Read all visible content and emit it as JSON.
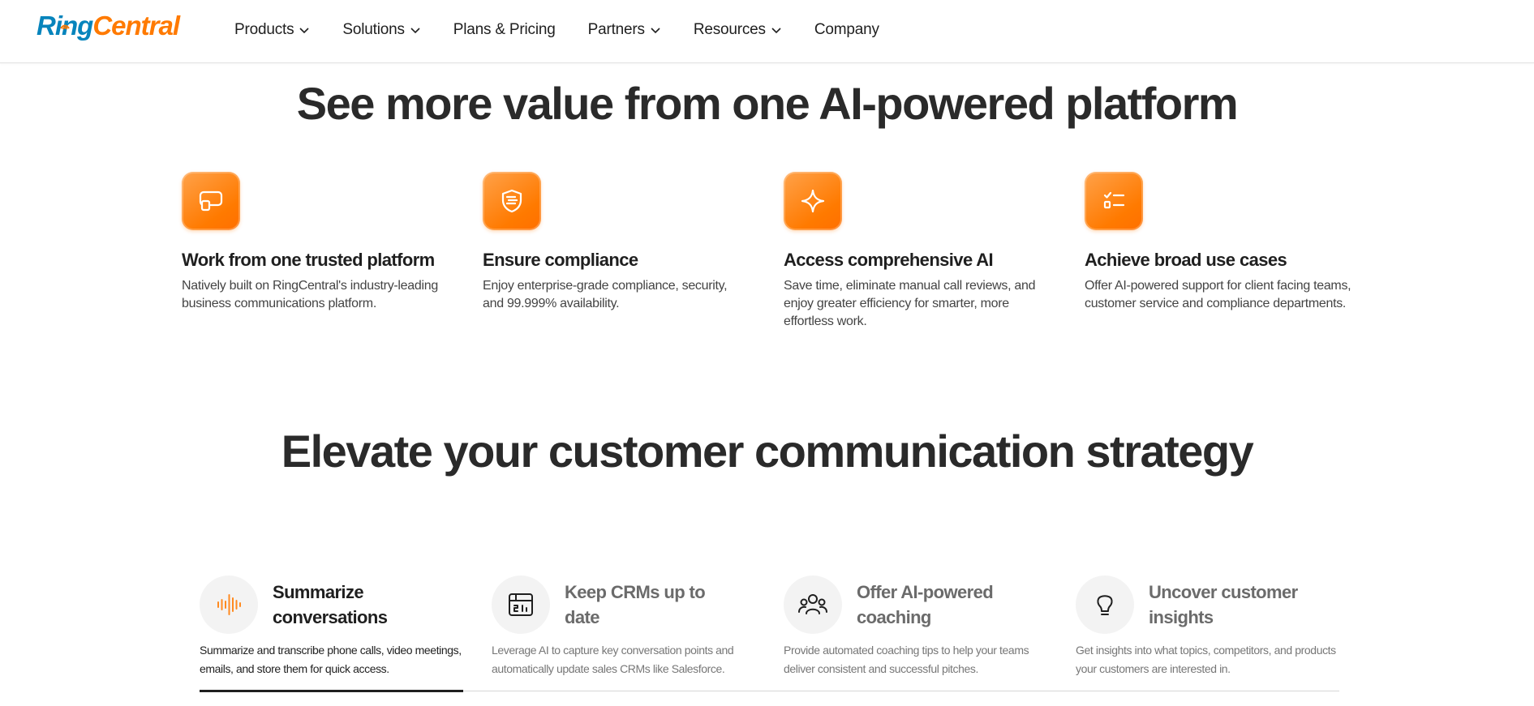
{
  "header": {
    "logo": {
      "ring": "Ring",
      "central": "Central"
    },
    "nav": [
      {
        "label": "Products",
        "has_dropdown": true
      },
      {
        "label": "Solutions",
        "has_dropdown": true
      },
      {
        "label": "Plans & Pricing",
        "has_dropdown": false
      },
      {
        "label": "Partners",
        "has_dropdown": true
      },
      {
        "label": "Resources",
        "has_dropdown": true
      },
      {
        "label": "Company",
        "has_dropdown": false
      }
    ]
  },
  "section_value": {
    "title": "See more value from one AI-powered platform",
    "features": [
      {
        "icon": "platform-icon",
        "title": "Work from one trusted platform",
        "desc": "Natively built on RingCentral's industry-leading business communications platform."
      },
      {
        "icon": "shield-icon",
        "title": "Ensure compliance",
        "desc": "Enjoy enterprise-grade compliance, security, and 99.999% availability."
      },
      {
        "icon": "sparkle-icon",
        "title": "Access comprehensive AI",
        "desc": "Save time, eliminate manual call reviews, and enjoy greater efficiency for smarter, more effortless work."
      },
      {
        "icon": "checklist-icon",
        "title": "Achieve broad use cases",
        "desc": "Offer AI-powered support for client facing teams, customer service and compliance departments."
      }
    ]
  },
  "section_strategy": {
    "title": "Elevate your customer communication strategy",
    "tabs": [
      {
        "icon": "audio-wave-icon",
        "title": "Summarize conversations",
        "desc": "Summarize and transcribe phone calls, video meetings, emails, and store them for quick access.",
        "active": true
      },
      {
        "icon": "crm-dashboard-icon",
        "title": "Keep CRMs up to date",
        "desc": "Leverage AI to capture key conversation points and automatically update sales CRMs like Salesforce.",
        "active": false
      },
      {
        "icon": "team-icon",
        "title": "Offer AI-powered coaching",
        "desc": "Provide automated coaching tips to help your teams deliver consistent and successful pitches.",
        "active": false
      },
      {
        "icon": "lightbulb-icon",
        "title": "Uncover customer insights",
        "desc": "Get insights into what topics, competitors, and products your customers are interested in.",
        "active": false
      }
    ]
  },
  "colors": {
    "brand_orange": "#ff7a00",
    "brand_blue": "#0684bc",
    "text_dark": "#2a2a2a"
  }
}
